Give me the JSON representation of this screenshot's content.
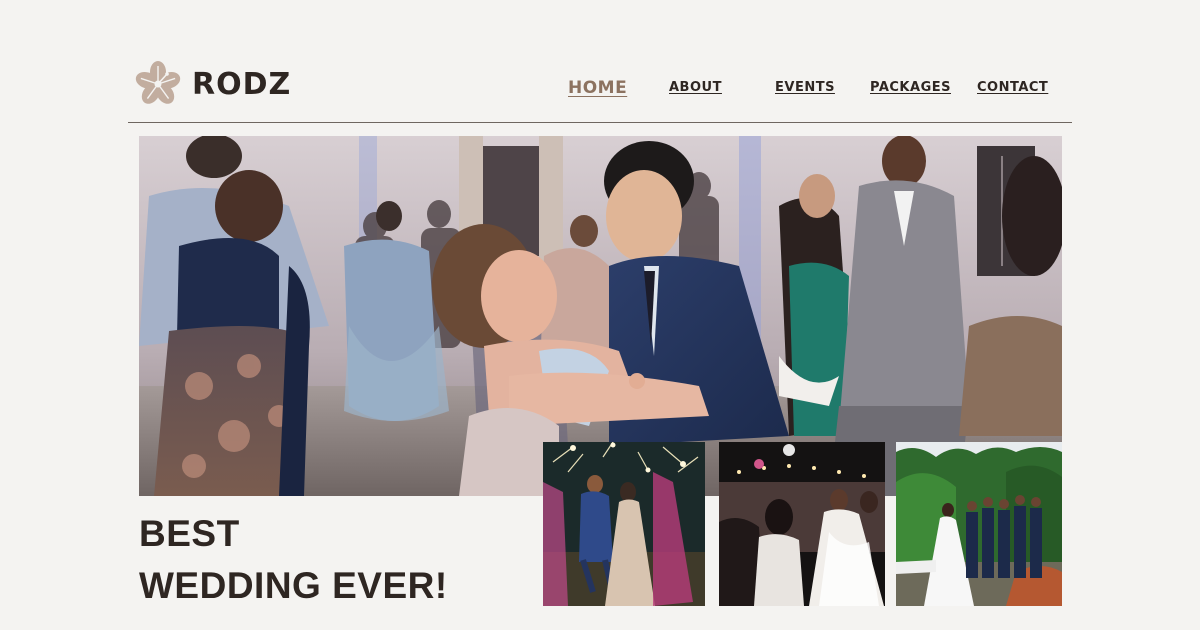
{
  "brand": {
    "name": "RODZ",
    "logo_icon": "hibiscus-flower-icon",
    "accent_color": "#8c7260"
  },
  "nav": {
    "items": [
      {
        "label": "HOME",
        "active": true
      },
      {
        "label": "ABOUT",
        "active": false
      },
      {
        "label": "EVENTS",
        "active": false
      },
      {
        "label": "PACKAGES",
        "active": false
      },
      {
        "label": "CONTACT",
        "active": false
      }
    ]
  },
  "hero": {
    "headline_line1": "BEST",
    "headline_line2": "WEDDING EVER!",
    "image": "couple-dancing-at-reception-photo"
  },
  "gallery": [
    {
      "image": "couple-walking-through-sparklers-photo"
    },
    {
      "image": "bride-dancing-with-guests-photo"
    },
    {
      "image": "bride-with-groomsmen-outdoors-photo"
    }
  ],
  "colors": {
    "background": "#f4f3f1",
    "text": "#2e2622"
  }
}
